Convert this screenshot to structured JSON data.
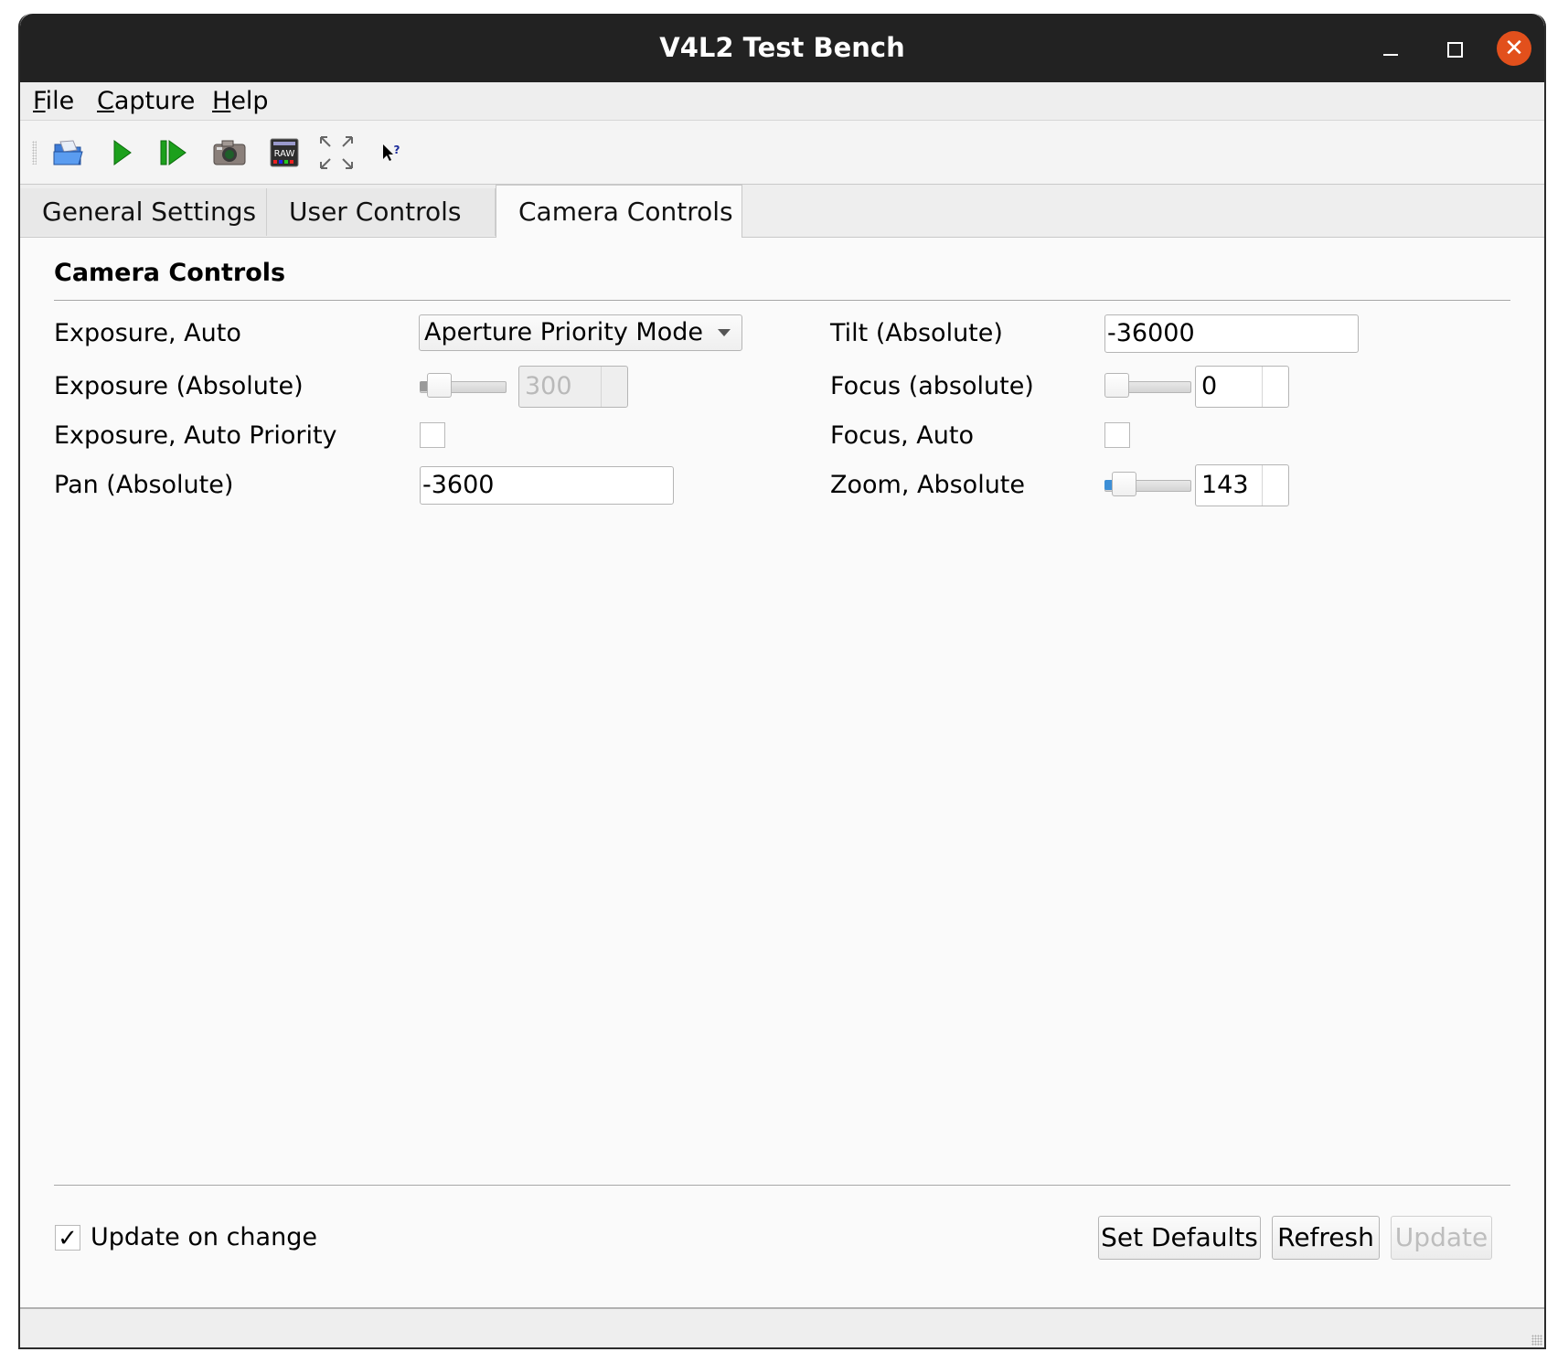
{
  "window": {
    "title": "V4L2 Test Bench",
    "controls": {
      "minimize_icon": "minimize-icon",
      "maximize_icon": "maximize-icon",
      "close_icon": "close-icon",
      "close_glyph": "✕",
      "close_color": "#e2501c"
    }
  },
  "menubar": {
    "items": [
      {
        "mnemonic": "F",
        "rest": "ile"
      },
      {
        "mnemonic": "C",
        "rest": "apture"
      },
      {
        "mnemonic": "H",
        "rest": "elp"
      }
    ]
  },
  "toolbar": {
    "items": [
      {
        "icon": "open-folder-icon"
      },
      {
        "icon": "play-icon"
      },
      {
        "icon": "step-play-icon"
      },
      {
        "icon": "camera-snapshot-icon"
      },
      {
        "icon": "raw-icon",
        "text": "RAW"
      },
      {
        "icon": "fullscreen-icon"
      },
      {
        "icon": "whats-this-icon",
        "text": "?"
      }
    ]
  },
  "tabs": [
    {
      "label": "General Settings",
      "active": false
    },
    {
      "label": "User Controls",
      "active": false
    },
    {
      "label": "Camera Controls",
      "active": true
    }
  ],
  "group": {
    "title": "Camera Controls",
    "left": [
      {
        "label": "Exposure, Auto",
        "type": "combo",
        "value": "Aperture Priority Mode"
      },
      {
        "label": "Exposure (Absolute)",
        "type": "slider-spin",
        "value": "300",
        "disabled": true,
        "slider_fraction": 0.03
      },
      {
        "label": "Exposure, Auto Priority",
        "type": "checkbox",
        "checked": false
      },
      {
        "label": "Pan (Absolute)",
        "type": "lineedit",
        "value": "-3600"
      }
    ],
    "right": [
      {
        "label": "Tilt (Absolute)",
        "type": "lineedit",
        "value": "-36000"
      },
      {
        "label": "Focus (absolute)",
        "type": "slider-spin",
        "value": "0",
        "slider_fraction": 0.0
      },
      {
        "label": "Focus, Auto",
        "type": "checkbox",
        "checked": false
      },
      {
        "label": "Zoom, Absolute",
        "type": "slider-spin",
        "value": "143",
        "slider_fraction": 0.03
      }
    ]
  },
  "footer": {
    "update_on_change": {
      "label": "Update on change",
      "checked": true,
      "glyph": "✓"
    },
    "buttons": {
      "set_defaults": "Set Defaults",
      "refresh": "Refresh",
      "update": "Update"
    }
  },
  "colors": {
    "slider_fill_active": "#3d8fd6",
    "slider_fill_disabled": "#9a9a9a"
  }
}
